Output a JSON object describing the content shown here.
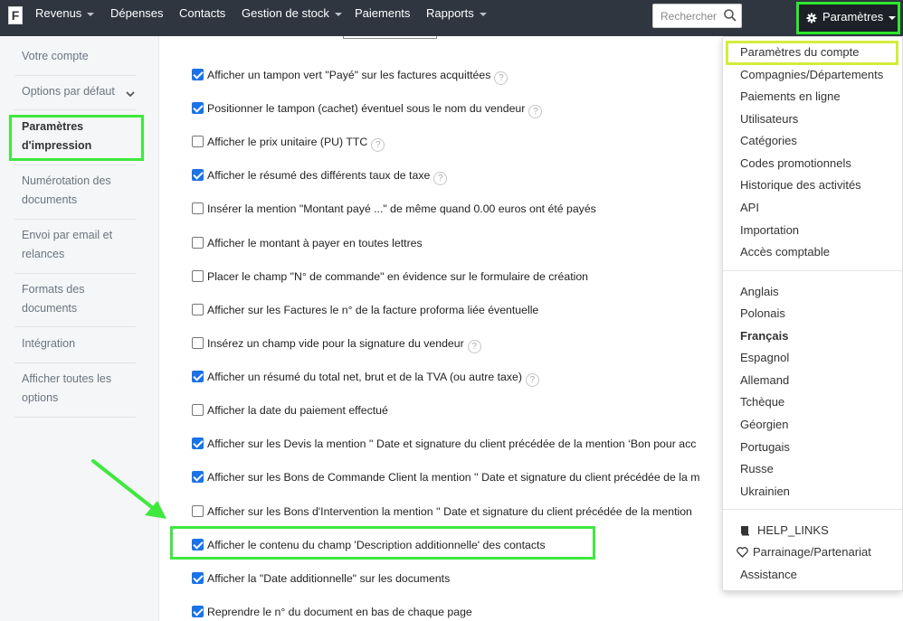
{
  "app": {
    "logo_letter": "F"
  },
  "navbar": {
    "items": [
      {
        "label": "Revenus"
      },
      {
        "label": "Dépenses"
      },
      {
        "label": "Contacts"
      },
      {
        "label": "Gestion de stock"
      },
      {
        "label": "Paiements"
      },
      {
        "label": "Rapports"
      }
    ],
    "search_placeholder": "Rechercher",
    "settings_label": "Paramètres"
  },
  "sidebar": {
    "items": [
      {
        "label": "Votre compte"
      },
      {
        "label": "Options par défaut"
      },
      {
        "label": "Paramètres d'impression"
      },
      {
        "label": "Numérotation des documents"
      },
      {
        "label": "Envoi par email et relances"
      },
      {
        "label": "Formats des documents"
      },
      {
        "label": "Intégration"
      },
      {
        "label": "Afficher toutes les options"
      }
    ],
    "active_index": 2
  },
  "options": [
    {
      "label": "Afficher un tampon vert \"Payé\" sur les factures acquittées",
      "checked": true,
      "help": true
    },
    {
      "label": "Positionner le tampon (cachet) éventuel sous le nom du vendeur",
      "checked": true,
      "help": true
    },
    {
      "label": "Afficher le prix unitaire (PU) TTC",
      "checked": false,
      "help": true
    },
    {
      "label": "Afficher le résumé des différents taux de taxe",
      "checked": true,
      "help": true
    },
    {
      "label": "Insérer la mention \"Montant payé ...\" de même quand 0.00 euros ont été payés",
      "checked": false,
      "help": false
    },
    {
      "label": "Afficher le montant à payer en toutes lettres",
      "checked": false,
      "help": false
    },
    {
      "label": "Placer le champ \"N° de commande\" en évidence sur le formulaire de création",
      "checked": false,
      "help": false
    },
    {
      "label": "Afficher sur les Factures le n° de la facture proforma liée éventuelle",
      "checked": false,
      "help": false
    },
    {
      "label": "Insérez un champ vide pour la signature du vendeur",
      "checked": false,
      "help": true
    },
    {
      "label": "Afficher un résumé du total net, brut et de la TVA (ou autre taxe)",
      "checked": true,
      "help": true
    },
    {
      "label": "Afficher la date du paiement effectué",
      "checked": false,
      "help": false
    },
    {
      "label": "Afficher sur les Devis la mention '' Date et signature du client précédée de la mention ‘Bon pour acc",
      "checked": true,
      "help": false
    },
    {
      "label": "Afficher sur les Bons de Commande Client la mention '' Date et signature du client précédée de la m",
      "checked": true,
      "help": false
    },
    {
      "label": "Afficher sur les Bons d'Intervention la mention '' Date et signature du client précédée de la mention",
      "checked": false,
      "help": false
    },
    {
      "label": "Afficher le contenu du champ 'Description additionnelle' des contacts",
      "checked": true,
      "help": false
    },
    {
      "label": "Afficher la \"Date additionnelle\" sur les documents",
      "checked": true,
      "help": false
    },
    {
      "label": "Reprendre le n° du document en bas de chaque page",
      "checked": true,
      "help": false
    }
  ],
  "dropdown": {
    "settings_items": [
      {
        "label": "Paramètres du compte"
      },
      {
        "label": "Compagnies/Départements"
      },
      {
        "label": "Paiements en ligne"
      },
      {
        "label": "Utilisateurs"
      },
      {
        "label": "Catégories"
      },
      {
        "label": "Codes promotionnels"
      },
      {
        "label": "Historique des activités"
      },
      {
        "label": "API"
      },
      {
        "label": "Importation"
      },
      {
        "label": "Accès comptable"
      }
    ],
    "languages": [
      {
        "label": "Anglais"
      },
      {
        "label": "Polonais"
      },
      {
        "label": "Français"
      },
      {
        "label": "Espagnol"
      },
      {
        "label": "Allemand"
      },
      {
        "label": "Tchèque"
      },
      {
        "label": "Géorgien"
      },
      {
        "label": "Portugais"
      },
      {
        "label": "Russe"
      },
      {
        "label": "Ukrainien"
      }
    ],
    "active_language_index": 2,
    "extra": [
      {
        "label": "HELP_LINKS",
        "icon": "book-icon"
      },
      {
        "label": "Parrainage/Partenariat",
        "icon": "heart-icon"
      },
      {
        "label": "Assistance",
        "icon": ""
      }
    ]
  },
  "colors": {
    "navbar_bg": "#2f3640",
    "highlight_green": "#3fe83f",
    "highlight_yellow": "#d4ec3b",
    "checkbox_blue": "#1a73e8"
  }
}
